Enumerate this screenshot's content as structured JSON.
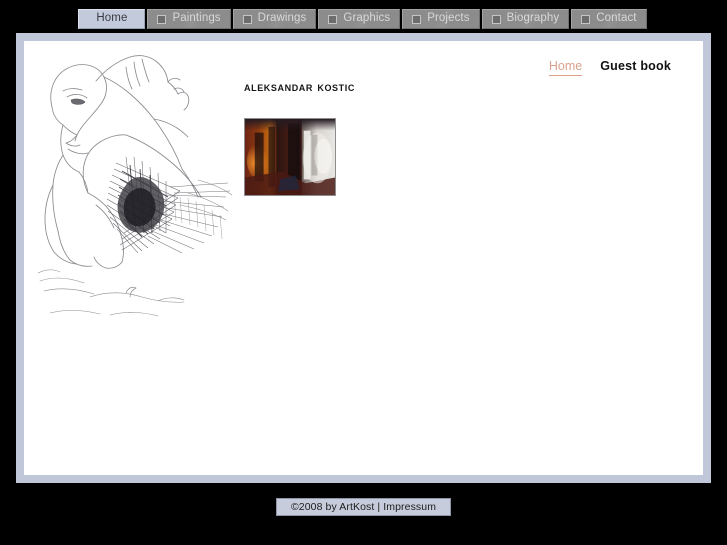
{
  "window": {
    "background_color": "#000000",
    "frame_color": "#bfc7d8",
    "page_color": "#ffffff"
  },
  "topnav": {
    "items": [
      {
        "label": "Home",
        "icon": "square-icon",
        "active": true
      },
      {
        "label": "Paintings",
        "icon": "square-icon",
        "active": false
      },
      {
        "label": "Drawings",
        "icon": "square-icon",
        "active": false
      },
      {
        "label": "Graphics",
        "icon": "square-icon",
        "active": false
      },
      {
        "label": "Projects",
        "icon": "square-icon",
        "active": false
      },
      {
        "label": "Biography",
        "icon": "square-icon",
        "active": false
      },
      {
        "label": "Contact",
        "icon": "square-icon",
        "active": false
      }
    ],
    "active_color": "#c3cadb",
    "inactive_color": "#8c8c8c"
  },
  "utilnav": {
    "current": "Home",
    "current_color": "#d9a18d",
    "link": "Guest book"
  },
  "main": {
    "title": "Aleksandar Kostic",
    "thumbnails": [
      {
        "alt": "abstract-painting-thumbnail"
      }
    ]
  },
  "artwork": {
    "left_sketch_alt": "pencil-sketch-figure"
  },
  "footer": {
    "copyright": "©2008 by ArtKost",
    "separator": "|",
    "impressum": "Impressum",
    "bar_color": "#c6ccdb"
  }
}
